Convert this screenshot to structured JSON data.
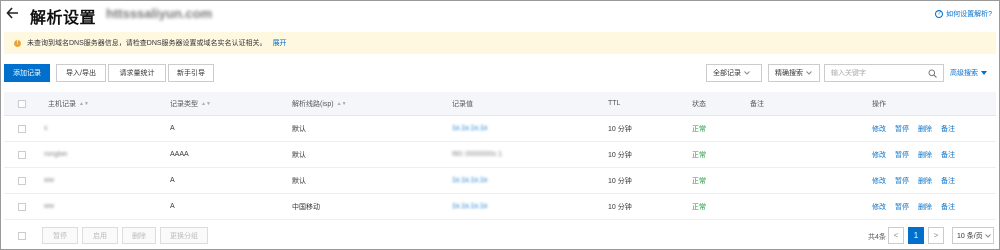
{
  "header": {
    "title": "解析设置",
    "domain": "httsssaliyun.com",
    "help_label": "如何设置解析?"
  },
  "notice": {
    "text": "未查询到域名DNS服务器信息，请检查DNS服务器设置或域名实名认证相关。",
    "link": "展开"
  },
  "toolbar": {
    "add_record": "添加记录",
    "import_export": "导入/导出",
    "request_stats": "请求量统计",
    "guide": "新手引导",
    "record_filter": "全部记录",
    "search_mode": "精确搜索",
    "search_placeholder": "输入关键字",
    "advanced_search": "高级搜索"
  },
  "table": {
    "columns": {
      "host": "主机记录",
      "type": "记录类型",
      "line": "解析线路(isp)",
      "value": "记录值",
      "ttl": "TTL",
      "status": "状态",
      "remark": "备注",
      "actions": "操作"
    },
    "rows": [
      {
        "host": "s",
        "type": "A",
        "line": "默认",
        "value": "1x.1x.1x.1x",
        "ttl": "10 分钟",
        "status": "正常",
        "remark": ""
      },
      {
        "host": "rongbei",
        "type": "AAAA",
        "line": "默认",
        "value": "f80::0000000c:1",
        "ttl": "10 分钟",
        "status": "正常",
        "remark": ""
      },
      {
        "host": "ww",
        "type": "A",
        "line": "默认",
        "value": "1x.1x.1x.1x",
        "ttl": "10 分钟",
        "status": "正常",
        "remark": ""
      },
      {
        "host": "ww",
        "type": "A",
        "line": "中国移动",
        "value": "1x.1x.1x.1x",
        "ttl": "10 分钟",
        "status": "正常",
        "remark": ""
      }
    ],
    "row_actions": [
      "修改",
      "暂停",
      "删除",
      "备注"
    ]
  },
  "footer": {
    "pause": "暂停",
    "enable": "启用",
    "delete": "删除",
    "change_group": "更换分组",
    "total": "共4条",
    "prev": "<",
    "page": "1",
    "next": ">",
    "page_size": "10 条/页"
  },
  "colors": {
    "accent": "#0070cc",
    "ok": "#1b9a3a",
    "notice_bg": "#fff8e1",
    "warn": "#e8a33a"
  }
}
